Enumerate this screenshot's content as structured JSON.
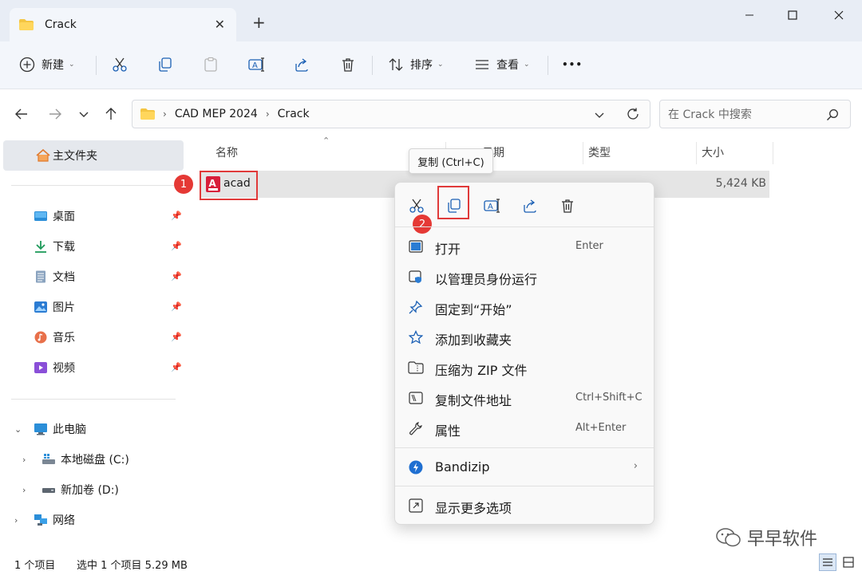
{
  "window": {
    "tab_title": "Crack",
    "close_tab": "✕",
    "new_tab": "+"
  },
  "toolbar": {
    "new_label": "新建",
    "sort_label": "排序",
    "view_label": "查看",
    "more_label": "•••"
  },
  "address": {
    "crumbs": [
      "CAD MEP 2024",
      "Crack"
    ],
    "search_placeholder": "在 Crack 中搜索"
  },
  "sidebar": {
    "home": "主文件夹",
    "quick_access": [
      {
        "label": "桌面",
        "icon": "desktop-icon"
      },
      {
        "label": "下载",
        "icon": "download-icon"
      },
      {
        "label": "文档",
        "icon": "document-icon"
      },
      {
        "label": "图片",
        "icon": "pictures-icon"
      },
      {
        "label": "音乐",
        "icon": "music-icon"
      },
      {
        "label": "视频",
        "icon": "video-icon"
      }
    ],
    "this_pc": "此电脑",
    "drives": [
      "本地磁盘 (C:)",
      "新加卷 (D:)"
    ],
    "network": "网络"
  },
  "columns": {
    "name": "名称",
    "date": "日期",
    "type": "类型",
    "size": "大小"
  },
  "files": [
    {
      "name": "acad",
      "size": "5,424 KB"
    }
  ],
  "tooltip": "复制 (Ctrl+C)",
  "context_menu": {
    "quick_actions": [
      "cut",
      "copy",
      "rename",
      "share",
      "delete"
    ],
    "items": [
      {
        "label": "打开",
        "key": "Enter"
      },
      {
        "label": "以管理员身份运行",
        "key": ""
      },
      {
        "label": "固定到“开始”",
        "key": ""
      },
      {
        "label": "添加到收藏夹",
        "key": ""
      },
      {
        "label": "压缩为 ZIP 文件",
        "key": ""
      },
      {
        "label": "复制文件地址",
        "key": "Ctrl+Shift+C"
      },
      {
        "label": "属性",
        "key": "Alt+Enter"
      },
      {
        "label": "Bandizip",
        "key": ""
      },
      {
        "label": "显示更多选项",
        "key": ""
      }
    ]
  },
  "annotations": {
    "step1": "1",
    "step2": "2"
  },
  "status": {
    "count": "1 个项目",
    "selected": "选中 1 个项目  5.29 MB"
  },
  "watermark": "早早软件",
  "colors": {
    "accent": "#0067c0",
    "highlight_red": "#e53935",
    "folder_yellow": "#f4c542",
    "autocad_red": "#d81e3a"
  }
}
